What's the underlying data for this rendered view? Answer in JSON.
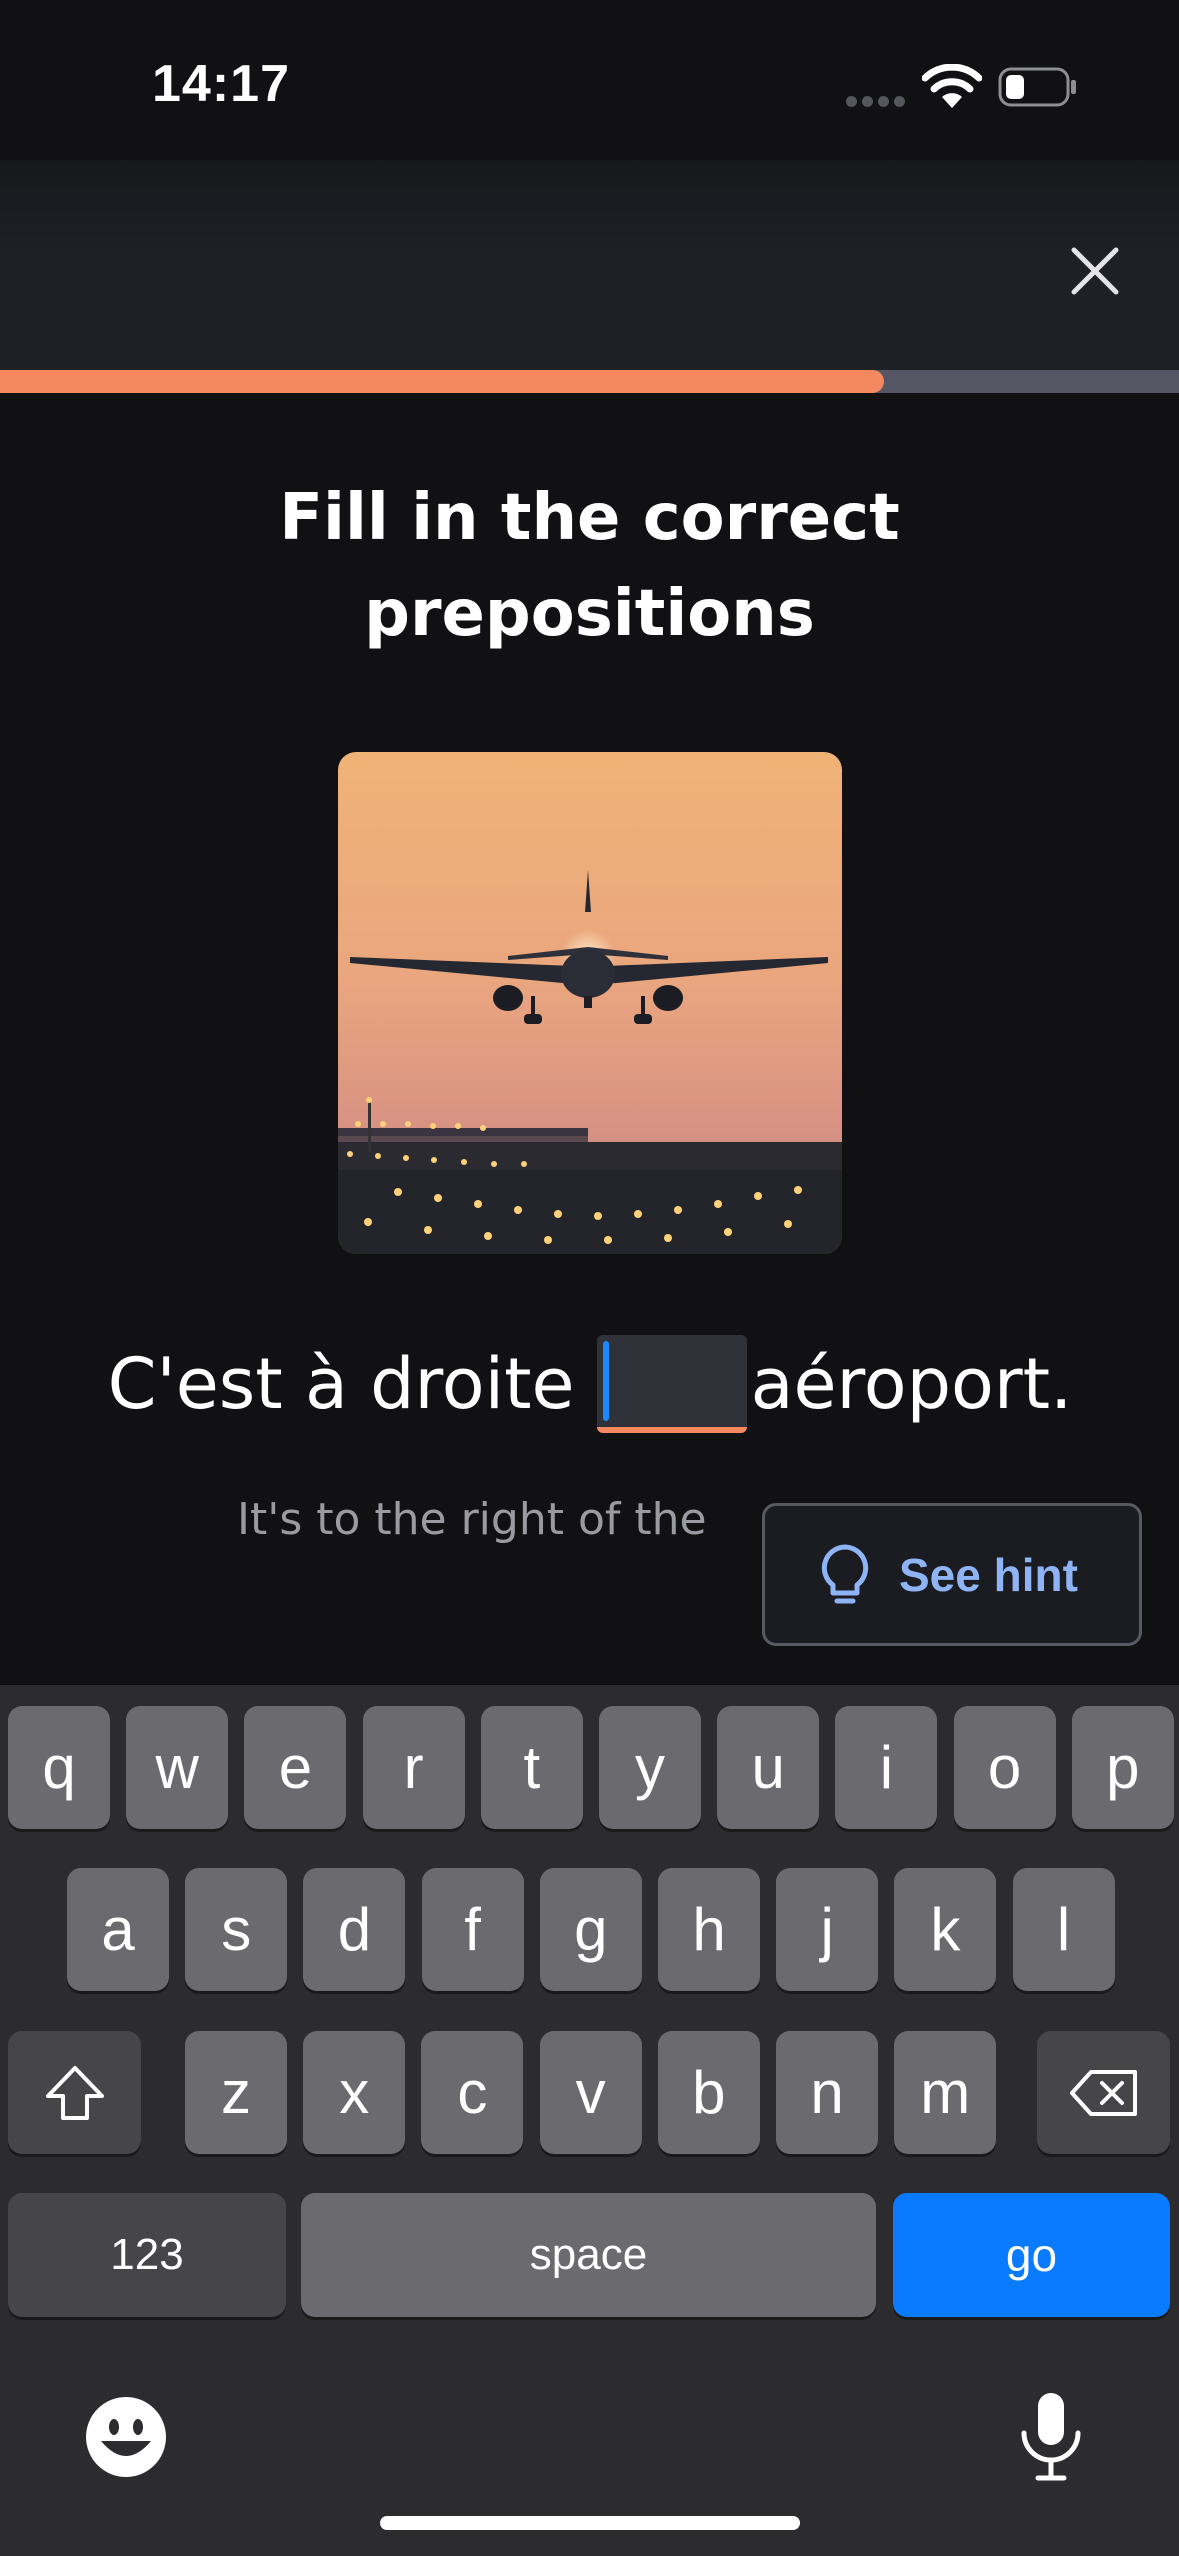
{
  "status_bar": {
    "time": "14:17",
    "icons": [
      "cellular-signal-icon",
      "wifi-icon",
      "battery-icon"
    ]
  },
  "header": {
    "close_icon": "close-icon"
  },
  "progress": {
    "value_percent": 75,
    "fill_color": "#f4895f",
    "track_color": "#545663"
  },
  "exercise": {
    "title": "Fill in the correct prepositions",
    "image": "airplane landing at sunset over airport runway lights",
    "sentence_before": "C'est à droite",
    "answer_value": "",
    "sentence_after": "aéroport.",
    "translation": "It's to the right of the",
    "hint_button": "See hint",
    "hint_icon": "lightbulb-icon"
  },
  "keyboard": {
    "row1": [
      "q",
      "w",
      "e",
      "r",
      "t",
      "y",
      "u",
      "i",
      "o",
      "p"
    ],
    "row2": [
      "a",
      "s",
      "d",
      "f",
      "g",
      "h",
      "j",
      "k",
      "l"
    ],
    "row3": [
      "z",
      "x",
      "c",
      "v",
      "b",
      "n",
      "m"
    ],
    "numbers_key": "123",
    "space_key": "space",
    "go_key": "go",
    "shift_icon": "shift-icon",
    "delete_icon": "delete-icon",
    "emoji_icon": "emoji-icon",
    "mic_icon": "microphone-icon",
    "accent_color": "#0a7aff"
  }
}
